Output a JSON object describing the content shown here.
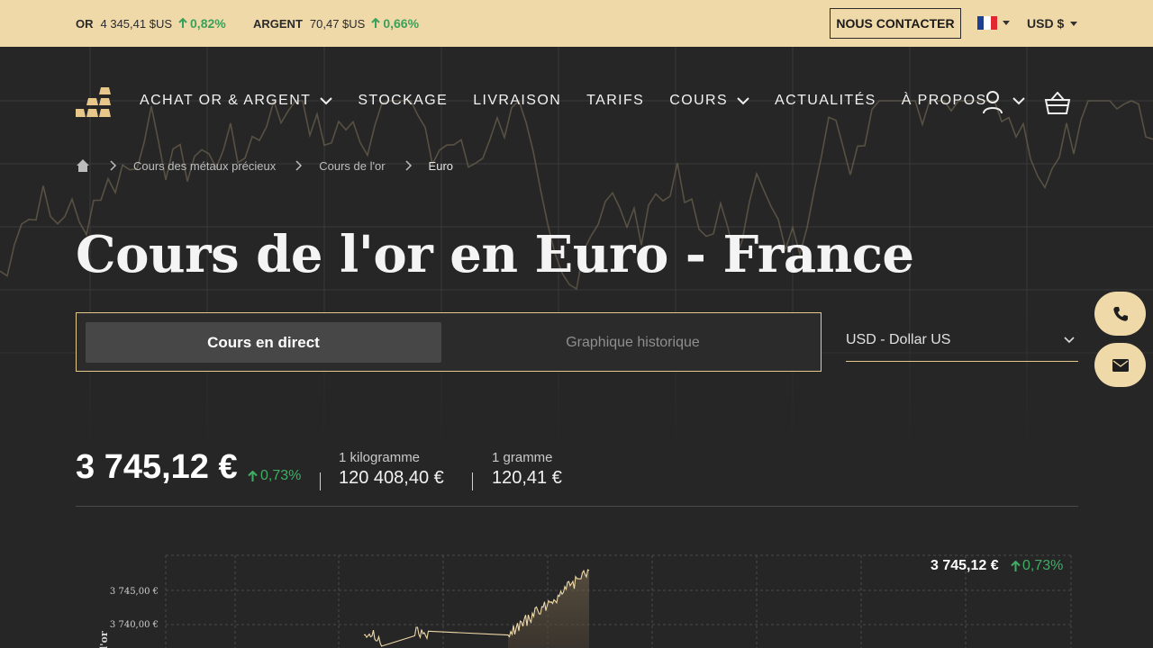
{
  "ticker": {
    "gold_label": "OR",
    "gold_price": "4 345,41 $US",
    "gold_change": "0,82%",
    "silver_label": "ARGENT",
    "silver_price": "70,47 $US",
    "silver_change": "0,66%",
    "contact_label": "NOUS CONTACTER",
    "currency_label": "USD $"
  },
  "nav": {
    "items": [
      {
        "label": "ACHAT OR & ARGENT",
        "has_dropdown": true
      },
      {
        "label": "STOCKAGE",
        "has_dropdown": false
      },
      {
        "label": "LIVRAISON",
        "has_dropdown": false
      },
      {
        "label": "TARIFS",
        "has_dropdown": false
      },
      {
        "label": "COURS",
        "has_dropdown": true
      },
      {
        "label": "ACTUALITÉS",
        "has_dropdown": false
      },
      {
        "label": "À PROPOS",
        "has_dropdown": false
      }
    ]
  },
  "breadcrumb": [
    "Cours des métaux précieux",
    "Cours de l'or",
    "Euro"
  ],
  "page_title": "Cours de l'or en Euro - France",
  "tabs": {
    "active": "Cours en direct",
    "inactive": "Graphique historique"
  },
  "currency_select": "USD - Dollar US",
  "price": {
    "main": "3 745,12 €",
    "change": "0,73%",
    "kg_label": "1 kilogramme",
    "kg_value": "120 408,40 €",
    "g_label": "1 gramme",
    "g_value": "120,41 €"
  },
  "chart_data": {
    "type": "area",
    "current_price": "3 745,12 €",
    "current_change": "0,73%",
    "y_ticks": [
      "3 745,00 €",
      "3 740,00 €"
    ],
    "ylabel": "l'or",
    "grid": true
  },
  "colors": {
    "accent": "#f0d9a8",
    "positive": "#3fae64",
    "background": "#262626"
  }
}
